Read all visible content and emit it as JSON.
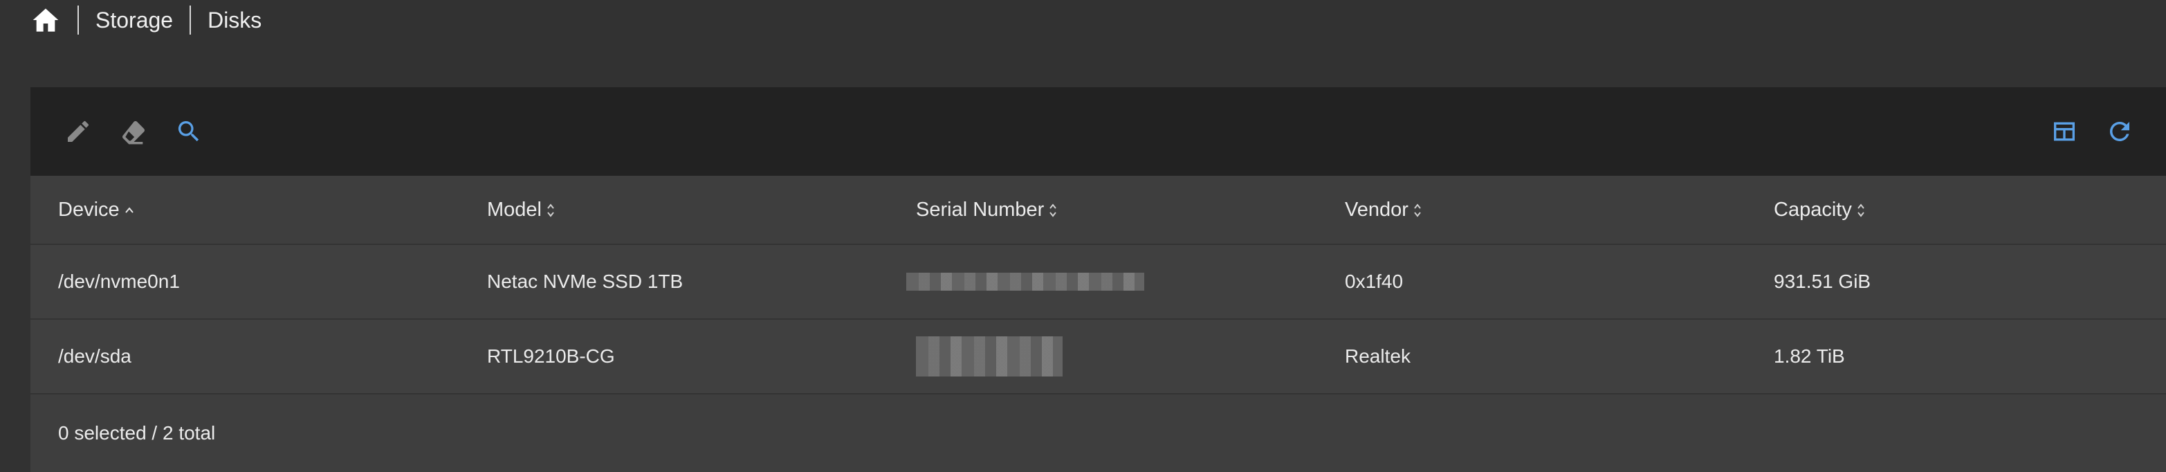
{
  "breadcrumb": {
    "items": [
      "Storage",
      "Disks"
    ]
  },
  "table": {
    "columns": [
      {
        "label": "Device",
        "sort": "asc"
      },
      {
        "label": "Model",
        "sort": "none"
      },
      {
        "label": "Serial Number",
        "sort": "none"
      },
      {
        "label": "Vendor",
        "sort": "none"
      },
      {
        "label": "Capacity",
        "sort": "none"
      }
    ],
    "rows": [
      {
        "device": "/dev/nvme0n1",
        "model": "Netac NVMe SSD 1TB",
        "vendor": "0x1f40",
        "capacity": "931.51 GiB"
      },
      {
        "device": "/dev/sda",
        "model": "RTL9210B-CG",
        "vendor": "Realtek",
        "capacity": "1.82 TiB"
      }
    ],
    "footer": "0 selected / 2 total"
  },
  "colors": {
    "accent": "#5aa0e6",
    "icon_muted": "#8a8a8a",
    "toolbar_bg": "#222222",
    "page_bg": "#323232"
  },
  "icons": [
    "home-icon",
    "pencil-icon",
    "eraser-icon",
    "search-icon",
    "table-layout-icon",
    "refresh-icon"
  ]
}
